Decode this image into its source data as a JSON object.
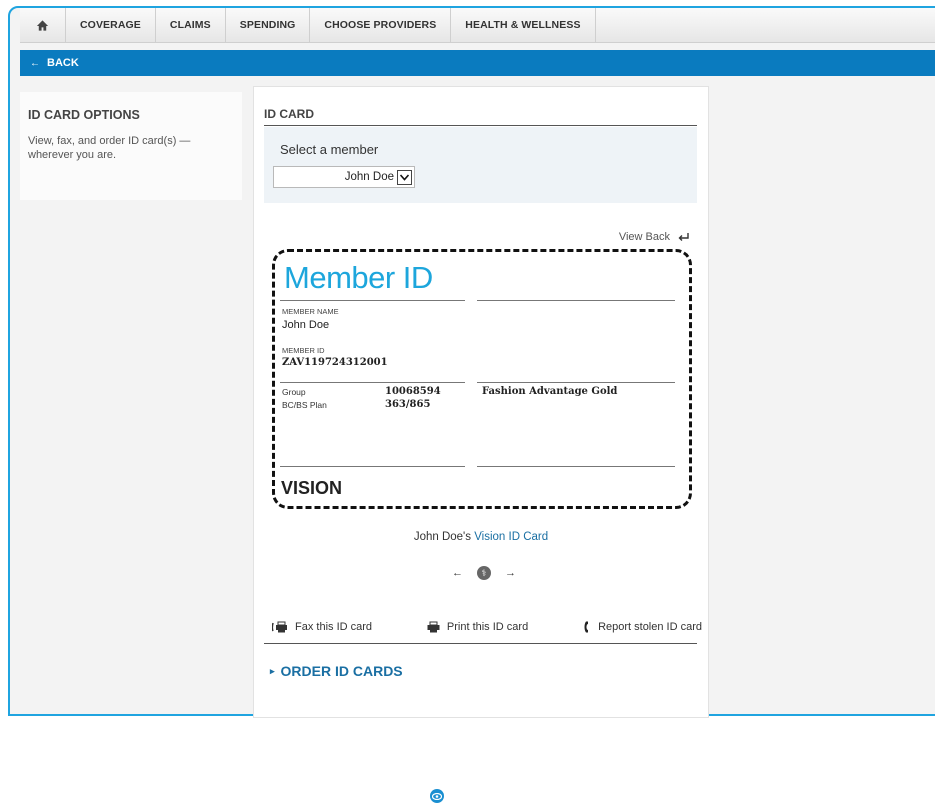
{
  "nav": {
    "items": [
      "COVERAGE",
      "CLAIMS",
      "SPENDING",
      "CHOOSE PROVIDERS",
      "HEALTH & WELLNESS"
    ]
  },
  "back": {
    "label": "BACK"
  },
  "sidebar": {
    "title": "ID CARD OPTIONS",
    "description": "View, fax, and order ID card(s) —wherever you are."
  },
  "panel": {
    "title": "ID CARD",
    "select_label": "Select a member",
    "selected_member": "John Doe",
    "view_back": "View Back"
  },
  "card": {
    "title": "Member ID",
    "member_name_label": "MEMBER NAME",
    "member_name": "John Doe",
    "member_id_label": "MEMBER ID",
    "member_id": "ZAV119724312001",
    "group_label": "Group",
    "group_value": "10068594",
    "plan_label": "BC/BS Plan",
    "plan_value": "363/865",
    "plan_name": "Fashion Advantage Gold",
    "type": "VISION"
  },
  "caption": {
    "owner": "John Doe's",
    "card_type": "Vision ID Card"
  },
  "actions": {
    "fax": "Fax this ID card",
    "print": "Print this ID card",
    "report": "Report stolen ID card"
  },
  "order": {
    "label": "ORDER ID CARDS"
  },
  "colors": {
    "accent": "#1da6dc",
    "header_blue": "#0a7bbf",
    "link_blue": "#1a6fa3"
  }
}
